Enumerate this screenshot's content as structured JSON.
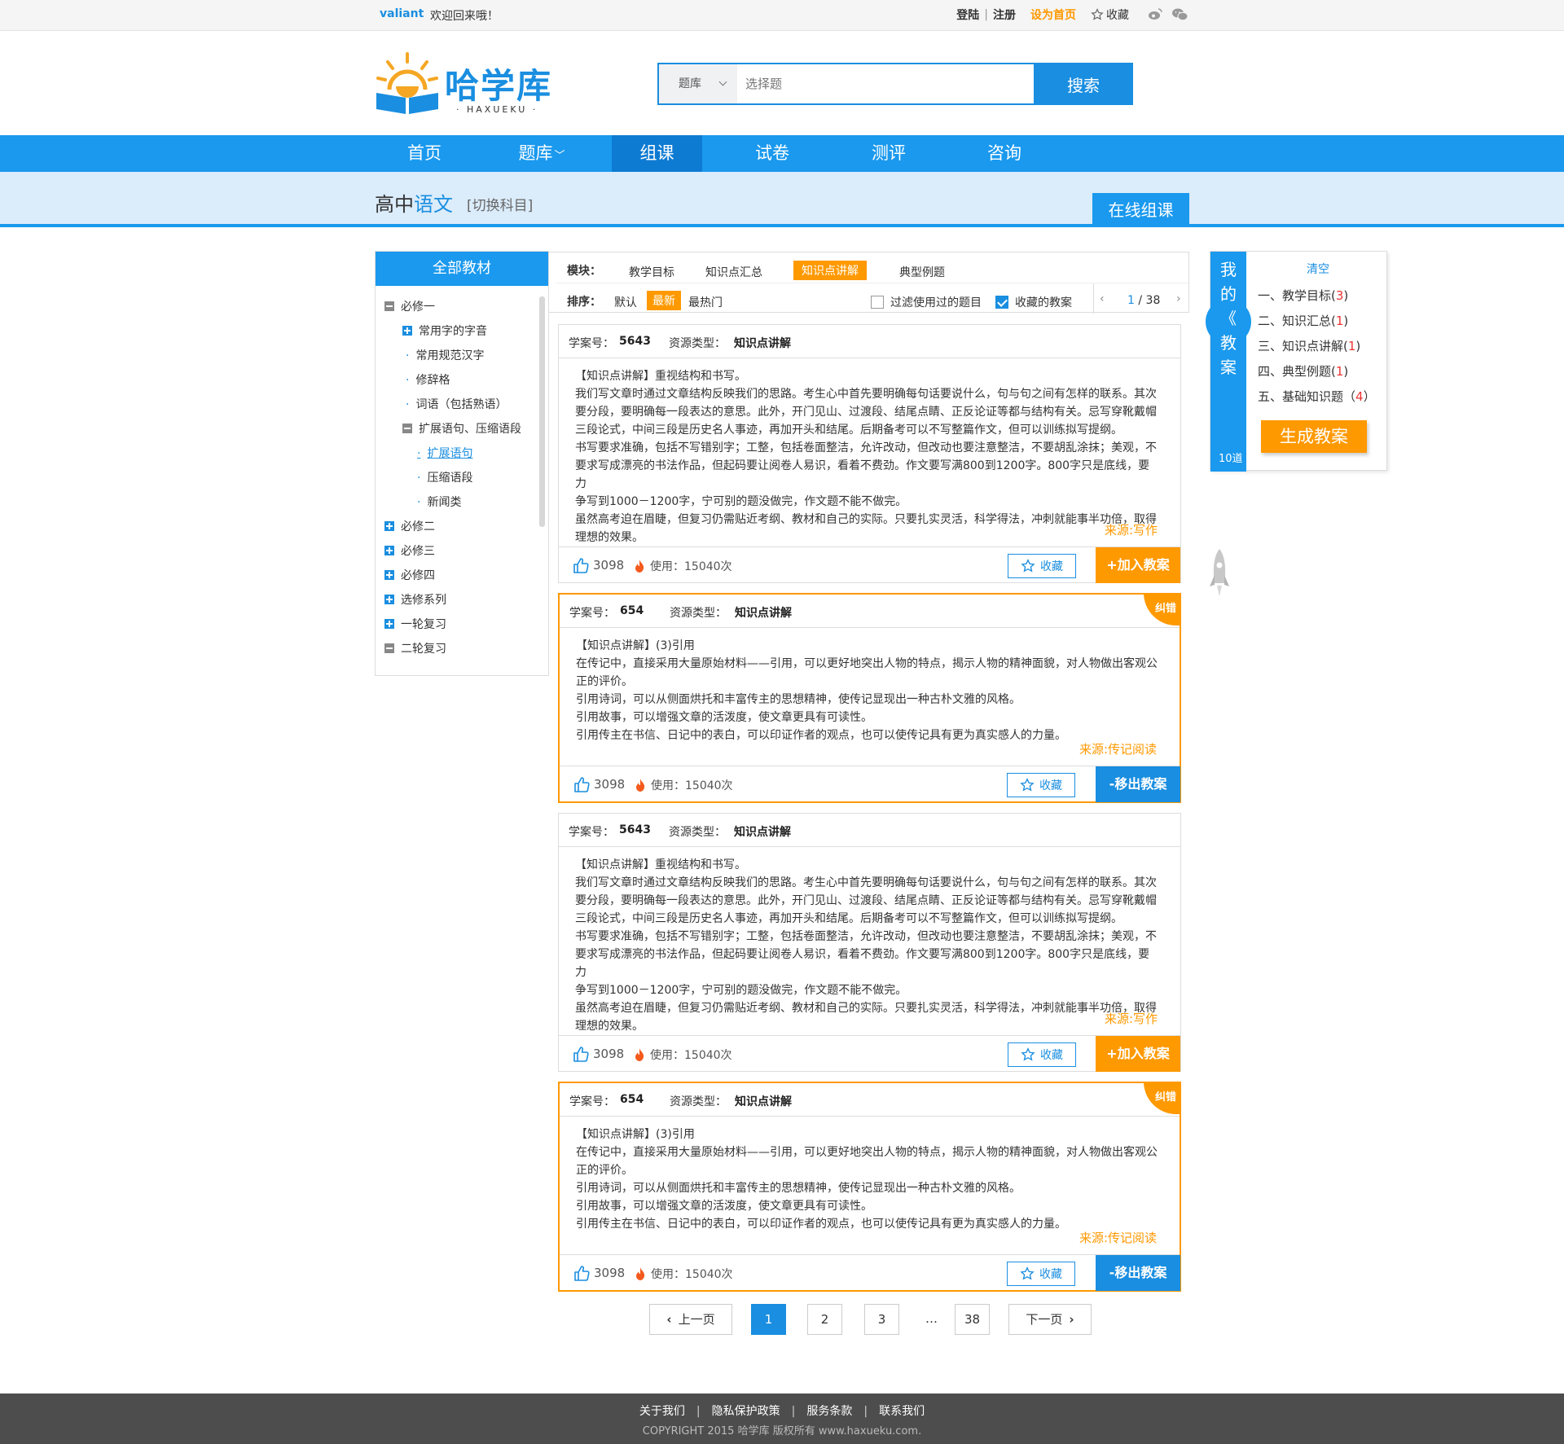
{
  "topbar": {
    "username": "valiant",
    "welcome": "欢迎回来哦！",
    "login": "登陆",
    "sep": "|",
    "register": "注册",
    "set_home": "设为首页",
    "favorite": "收藏"
  },
  "logo": {
    "brand": "哈学库",
    "sub": "· HAXUEKU ·"
  },
  "search": {
    "category": "题库",
    "placeholder": "选择题",
    "button": "搜索"
  },
  "nav": {
    "items": [
      "首页",
      "题库",
      "组课",
      "试卷",
      "测评",
      "咨询"
    ],
    "active": "组课"
  },
  "subject": {
    "level": "高中",
    "name": "语文",
    "switch": "[切换科目]",
    "online_button": "在线组课"
  },
  "tree": {
    "title": "全部教材",
    "nodes": [
      "必修一",
      "常用字的字音",
      "常用规范汉字",
      "修辞格",
      "词语（包括熟语）",
      "扩展语句、压缩语段",
      "扩展语句",
      "压缩语段",
      "新闻类",
      "必修二",
      "必修三",
      "必修四",
      "选修系列",
      "一轮复习",
      "二轮复习"
    ]
  },
  "filter": {
    "module_label": "模块：",
    "modules": [
      "教学目标",
      "知识点汇总",
      "知识点讲解",
      "典型例题"
    ],
    "sort_label": "排序：",
    "sorts": [
      "默认",
      "最新",
      "最热门"
    ],
    "filter_used": "过滤使用过的题目",
    "favorited": "收藏的教案",
    "page": "1",
    "total": "/ 38"
  },
  "cards": [
    {
      "id_label": "学案号：",
      "id": "5643",
      "type_label": "资源类型：",
      "type": "知识点讲解",
      "lines": [
        "【知识点讲解】重视结构和书写。",
        "我们写文章时通过文章结构反映我们的思路。考生心中首先要明确每句话要说什么，句与句之间有怎样的联系。其次",
        "要分段，要明确每一段表达的意思。此外，开门见山、过渡段、结尾点睛、正反论证等都与结构有关。忌写穿靴戴帽",
        "三段论式，中间三段是历史名人事迹，再加开头和结尾。后期备考可以不写整篇作文，但可以训练拟写提纲。",
        "书写要求准确，包括不写错别字；工整，包括卷面整洁，允许改动，但改动也要注意整洁，不要胡乱涂抹；美观，不",
        "要求写成漂亮的书法作品，但起码要让阅卷人易识，看着不费劲。作文要写满800到1200字。800字只是底线，要力",
        "争写到1000－1200字，宁可别的题没做完，作文题不能不做完。",
        "虽然高考迫在眉睫，但复习仍需贴近考纲、教材和自己的实际。只要扎实灵活，科学得法，冲刺就能事半功倍，取得",
        "理想的效果。"
      ],
      "source": "来源:写作",
      "likes": "3098",
      "uses": "使用：15040次",
      "collect": "收藏",
      "action": "+加入教案"
    },
    {
      "id_label": "学案号：",
      "id": "654",
      "type_label": "资源类型：",
      "type": "知识点讲解",
      "corner": "纠错",
      "lines": [
        "【知识点讲解】(3)引用",
        "在传记中，直接采用大量原始材料——引用，可以更好地突出人物的特点，揭示人物的精神面貌，对人物做出客观公",
        "正的评价。",
        "引用诗词，可以从侧面烘托和丰富传主的思想精神，使传记显现出一种古朴文雅的风格。",
        "引用故事，可以增强文章的活泼度，使文章更具有可读性。",
        "引用传主在书信、日记中的表白，可以印证作者的观点，也可以使传记具有更为真实感人的力量。"
      ],
      "source": "来源:传记阅读",
      "likes": "3098",
      "uses": "使用：15040次",
      "collect": "收藏",
      "action": "-移出教案"
    },
    {
      "id_label": "学案号：",
      "id": "5643",
      "type_label": "资源类型：",
      "type": "知识点讲解",
      "lines": [
        "【知识点讲解】重视结构和书写。",
        "我们写文章时通过文章结构反映我们的思路。考生心中首先要明确每句话要说什么，句与句之间有怎样的联系。其次",
        "要分段，要明确每一段表达的意思。此外，开门见山、过渡段、结尾点睛、正反论证等都与结构有关。忌写穿靴戴帽",
        "三段论式，中间三段是历史名人事迹，再加开头和结尾。后期备考可以不写整篇作文，但可以训练拟写提纲。",
        "书写要求准确，包括不写错别字；工整，包括卷面整洁，允许改动，但改动也要注意整洁，不要胡乱涂抹；美观，不",
        "要求写成漂亮的书法作品，但起码要让阅卷人易识，看着不费劲。作文要写满800到1200字。800字只是底线，要力",
        "争写到1000－1200字，宁可别的题没做完，作文题不能不做完。",
        "虽然高考迫在眉睫，但复习仍需贴近考纲、教材和自己的实际。只要扎实灵活，科学得法，冲刺就能事半功倍，取得",
        "理想的效果。"
      ],
      "source": "来源:写作",
      "likes": "3098",
      "uses": "使用：15040次",
      "collect": "收藏",
      "action": "+加入教案"
    },
    {
      "id_label": "学案号：",
      "id": "654",
      "type_label": "资源类型：",
      "type": "知识点讲解",
      "corner": "纠错",
      "lines": [
        "【知识点讲解】(3)引用",
        "在传记中，直接采用大量原始材料——引用，可以更好地突出人物的特点，揭示人物的精神面貌，对人物做出客观公",
        "正的评价。",
        "引用诗词，可以从侧面烘托和丰富传主的思想精神，使传记显现出一种古朴文雅的风格。",
        "引用故事，可以增强文章的活泼度，使文章更具有可读性。",
        "引用传主在书信、日记中的表白，可以印证作者的观点，也可以使传记具有更为真实感人的力量。"
      ],
      "source": "来源:传记阅读",
      "likes": "3098",
      "uses": "使用：15040次",
      "collect": "收藏",
      "action": "-移出教案"
    }
  ],
  "pagination": {
    "prev": "上一页",
    "pages": [
      "1",
      "2",
      "3",
      "…",
      "38"
    ],
    "next": "下一页"
  },
  "mycase": {
    "tab_chars": [
      "我",
      "的",
      "《",
      "教",
      "案"
    ],
    "count": "10道",
    "clear": "清空",
    "items": [
      {
        "label": "一、教学目标",
        "open": "(",
        "n": "3",
        "close": ")"
      },
      {
        "label": "二、知识汇总",
        "open": "(",
        "n": "1",
        "close": ")"
      },
      {
        "label": "三、知识点讲解",
        "open": "(",
        "n": "1",
        "close": ")"
      },
      {
        "label": "四、典型例题",
        "open": "(",
        "n": "1",
        "close": ")"
      },
      {
        "label": "五、基础知识题",
        "open": "（",
        "n": "4",
        "close": "）"
      }
    ],
    "generate": "生成教案"
  },
  "footer": {
    "links": [
      "关于我们",
      "隐私保护政策",
      "服务条款",
      "联系我们"
    ],
    "copyright": "COPYRIGHT 2015  哈学库  版权所有  www.haxueku.com."
  },
  "colors": {
    "primary": "#1a99ee",
    "accent": "#ff9900",
    "footer": "#4d4d4d"
  }
}
